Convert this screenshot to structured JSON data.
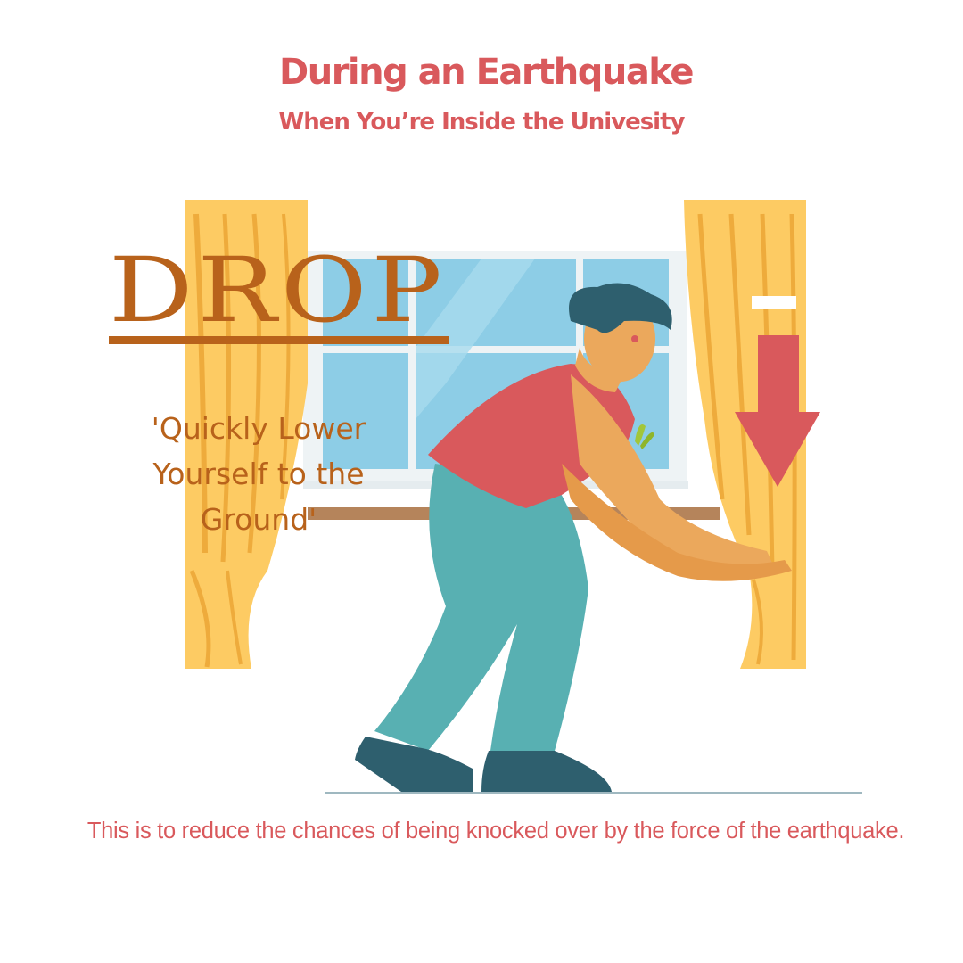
{
  "header": {
    "title": "During an Earthquake",
    "subtitle": "When You’re Inside the Univesity"
  },
  "instruction": {
    "action": "DROP",
    "caption": "'Quickly Lower Yourself to the Ground'"
  },
  "footer": {
    "note": "This is to reduce the chances of being knocked over by the force of the earthquake."
  },
  "illustration": {
    "subject": "person crouching while holding curtains",
    "icons": [
      "down-arrow-icon",
      "curtain-left",
      "curtain-right",
      "window",
      "plant"
    ]
  },
  "colors": {
    "heading": "#d9595c",
    "drop_text": "#b8621b",
    "curtain": "#fdcb63",
    "curtain_fold": "#eeab3c",
    "window_glass": "#8dcde6",
    "shirt": "#d9595c",
    "pants": "#58b0b2",
    "hair": "#2e5f6e",
    "skin": "#eba85c",
    "arrow": "#d9595c"
  }
}
